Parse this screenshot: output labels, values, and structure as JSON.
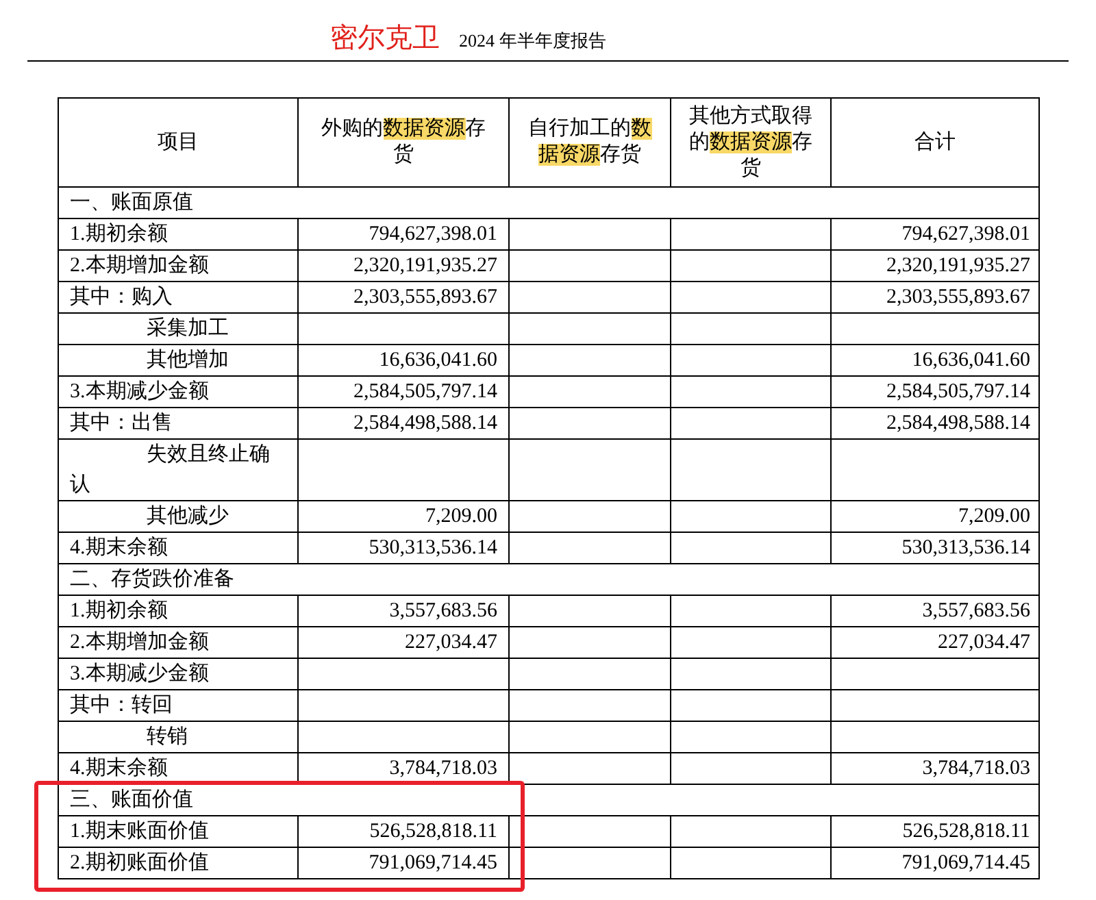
{
  "header": {
    "company": "密尔克卫",
    "report": "2024 年半年度报告"
  },
  "table": {
    "columns": [
      {
        "segments": [
          {
            "text": "项目",
            "highlighted": false
          }
        ]
      },
      {
        "segments": [
          {
            "text": "外购的",
            "highlighted": false
          },
          {
            "text": "数据资源",
            "highlighted": true
          },
          {
            "text": "存货",
            "highlighted": false
          }
        ]
      },
      {
        "segments": [
          {
            "text": "自行加工的",
            "highlighted": false
          },
          {
            "text": "数据资源",
            "highlighted": true
          },
          {
            "text": "存货",
            "highlighted": false
          }
        ]
      },
      {
        "segments": [
          {
            "text": "其他方式取得的",
            "highlighted": false
          },
          {
            "text": "数据资源",
            "highlighted": true
          },
          {
            "text": "存货",
            "highlighted": false
          }
        ]
      },
      {
        "segments": [
          {
            "text": "合计",
            "highlighted": false
          }
        ]
      }
    ],
    "sections": [
      {
        "label": "一、账面原值",
        "annotated": false,
        "rows": [
          {
            "label": "1.期初余额",
            "purchased": "794,627,398.01",
            "total": "794,627,398.01"
          },
          {
            "label": "2.本期增加金额",
            "purchased": "2,320,191,935.27",
            "total": "2,320,191,935.27"
          },
          {
            "label": "其中：购入",
            "purchased": "2,303,555,893.67",
            "total": "2,303,555,893.67",
            "children": [
              {
                "label": "采集加工"
              },
              {
                "label": "其他增加",
                "purchased": "16,636,041.60",
                "total": "16,636,041.60"
              }
            ]
          },
          {
            "label": "3.本期减少金额",
            "purchased": "2,584,505,797.14",
            "total": "2,584,505,797.14"
          },
          {
            "label": "其中：出售",
            "purchased": "2,584,498,588.14",
            "total": "2,584,498,588.14",
            "children": [
              {
                "label": "失效且终止确认"
              },
              {
                "label": "其他减少",
                "purchased": "7,209.00",
                "total": "7,209.00"
              }
            ]
          },
          {
            "label": "4.期末余额",
            "purchased": "530,313,536.14",
            "total": "530,313,536.14"
          }
        ]
      },
      {
        "label": "二、存货跌价准备",
        "annotated": false,
        "rows": [
          {
            "label": "1.期初余额",
            "purchased": "3,557,683.56",
            "total": "3,557,683.56"
          },
          {
            "label": "2.本期增加金额",
            "purchased": "227,034.47",
            "total": "227,034.47"
          },
          {
            "label": "3.本期减少金额"
          },
          {
            "label": "其中：转回",
            "children": [
              {
                "label": "转销"
              }
            ]
          },
          {
            "label": "4.期末余额",
            "purchased": "3,784,718.03",
            "total": "3,784,718.03"
          }
        ]
      },
      {
        "label": "三、账面价值",
        "annotated": true,
        "rows": [
          {
            "label": "1.期末账面价值",
            "purchased": "526,528,818.11",
            "total": "526,528,818.11"
          },
          {
            "label": "2.期初账面价值",
            "purchased": "791,069,714.45",
            "total": "791,069,714.45"
          }
        ]
      }
    ]
  }
}
